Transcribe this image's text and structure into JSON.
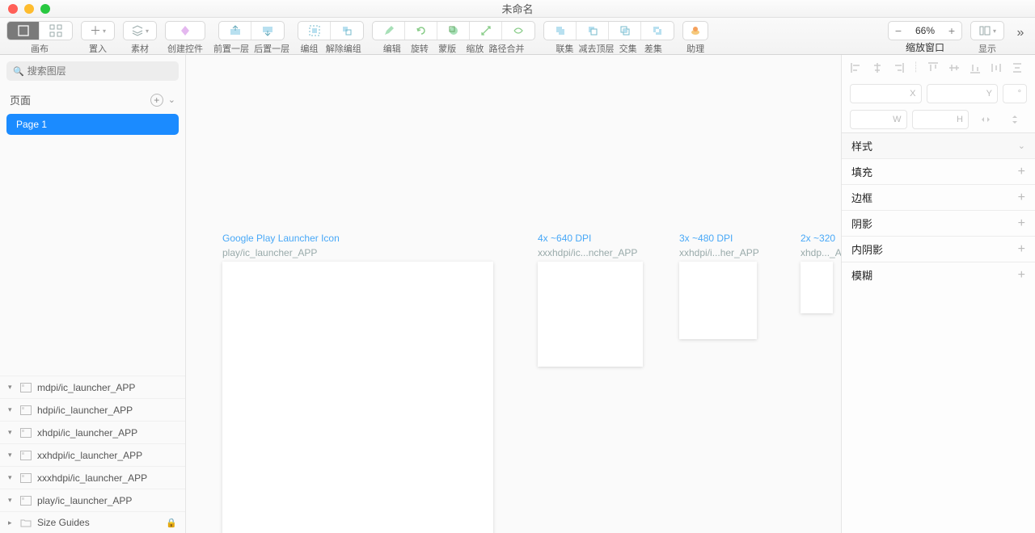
{
  "window": {
    "title": "未命名"
  },
  "toolbar": {
    "canvas": "画布",
    "insert": "置入",
    "assets": "素材",
    "create_widget": "创建控件",
    "forward": "前置一层",
    "backward": "后置一层",
    "group": "编组",
    "ungroup": "解除编组",
    "edit": "编辑",
    "rotate": "旋转",
    "mask": "蒙版",
    "scale": "缩放",
    "path_merge": "路径合并",
    "union": "联集",
    "subtract": "减去顶层",
    "intersect": "交集",
    "difference": "差集",
    "assistant": "助理",
    "zoom_window": "缩放窗口",
    "display": "显示",
    "zoom_value": "66%"
  },
  "sidebar": {
    "search_placeholder": "搜索图层",
    "pages_label": "页面",
    "page1": "Page 1",
    "layers": [
      "mdpi/ic_launcher_APP",
      "hdpi/ic_launcher_APP",
      "xhdpi/ic_launcher_APP",
      "xxhdpi/ic_launcher_APP",
      "xxxhdpi/ic_launcher_APP",
      "play/ic_launcher_APP"
    ],
    "size_guides": "Size Guides"
  },
  "canvas": {
    "art1": {
      "title": "Google Play Launcher Icon",
      "sub": "play/ic_launcher_APP"
    },
    "art2": {
      "title": "4x ~640 DPI",
      "sub": "xxxhdpi/ic...ncher_APP"
    },
    "art3": {
      "title": "3x ~480 DPI",
      "sub": "xxhdpi/i...her_APP"
    },
    "art4": {
      "title": "2x ~320",
      "sub": "xhdp..._A"
    }
  },
  "inspector": {
    "x": "X",
    "y": "Y",
    "deg": "°",
    "w": "W",
    "h": "H",
    "style": "样式",
    "fill": "填充",
    "border": "边框",
    "shadow": "阴影",
    "inner_shadow": "内阴影",
    "blur": "模糊"
  }
}
